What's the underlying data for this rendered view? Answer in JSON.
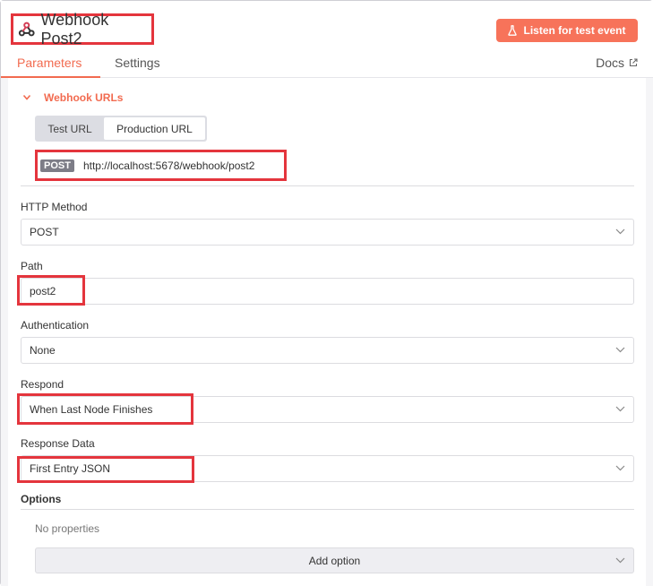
{
  "header": {
    "title": "Webhook Post2",
    "listen_label": "Listen for test event",
    "tabs": [
      {
        "label": "Parameters",
        "active": true
      },
      {
        "label": "Settings",
        "active": false
      }
    ],
    "docs_label": "Docs"
  },
  "webhook_urls": {
    "section_label": "Webhook URLs",
    "toggle": {
      "test": "Test URL",
      "production": "Production URL",
      "selected": "Production URL"
    },
    "method_badge": "POST",
    "url": "http://localhost:5678/webhook/post2"
  },
  "fields": {
    "http_method": {
      "label": "HTTP Method",
      "value": "POST"
    },
    "path": {
      "label": "Path",
      "value": "post2"
    },
    "authentication": {
      "label": "Authentication",
      "value": "None"
    },
    "respond": {
      "label": "Respond",
      "value": "When Last Node Finishes"
    },
    "response_data": {
      "label": "Response Data",
      "value": "First Entry JSON"
    }
  },
  "options": {
    "label": "Options",
    "empty_text": "No properties",
    "add_label": "Add option"
  },
  "colors": {
    "accent": "#f26b50",
    "button": "#f7735a",
    "highlight": "#e4353d",
    "badge": "#7d7d87"
  },
  "icons": [
    "webhook-icon",
    "flask-icon",
    "external-link-icon",
    "chevron-down-icon",
    "caret-down-icon"
  ]
}
